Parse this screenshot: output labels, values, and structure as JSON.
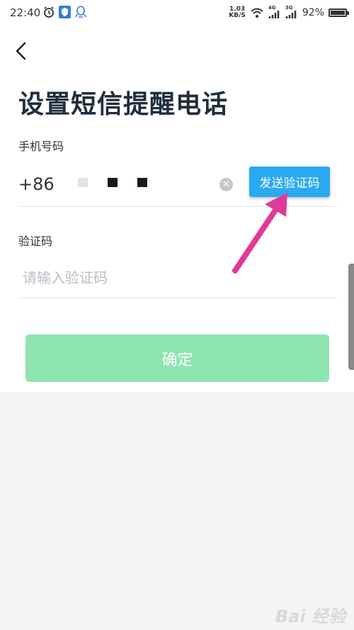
{
  "status_bar": {
    "time": "22:40",
    "net_speed_value": "1.03",
    "net_speed_unit": "KB/S",
    "signal1": "4G",
    "signal2": "3G",
    "battery_text": "92%",
    "battery_level": 0.92
  },
  "page": {
    "title": "设置短信提醒电话",
    "phone_label": "手机号码",
    "country_code": "+86",
    "send_code_label": "发送验证码",
    "code_label": "验证码",
    "code_placeholder": "请输入验证码",
    "confirm_label": "确定"
  },
  "overlay": {
    "arrow_color": "#e0399a"
  },
  "watermark": {
    "text": "Bai 经验"
  }
}
